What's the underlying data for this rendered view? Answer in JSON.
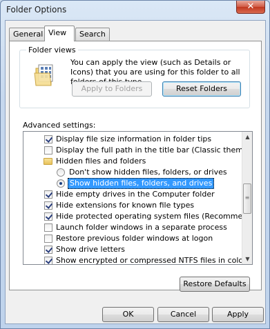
{
  "window": {
    "title": "Folder Options",
    "close_glyph": "✕"
  },
  "tabs": [
    {
      "label": "General",
      "active": false
    },
    {
      "label": "View",
      "active": true
    },
    {
      "label": "Search",
      "active": false
    }
  ],
  "folder_views": {
    "legend": "Folder views",
    "description": "You can apply the view (such as Details or Icons) that you are using for this folder to all folders of this type.",
    "icon": "folder-views-icon",
    "apply_label": "Apply to Folders",
    "reset_label": "Reset Folders"
  },
  "advanced": {
    "label": "Advanced settings:",
    "items": [
      {
        "kind": "checkbox",
        "label": "Display file size information in folder tips",
        "checked": true,
        "indent": 1
      },
      {
        "kind": "checkbox",
        "label": "Display the full path in the title bar (Classic theme only)",
        "checked": false,
        "indent": 1
      },
      {
        "kind": "folder",
        "label": "Hidden files and folders",
        "indent": 1
      },
      {
        "kind": "radio",
        "label": "Don't show hidden files, folders, or drives",
        "checked": false,
        "indent": 2
      },
      {
        "kind": "radio",
        "label": "Show hidden files, folders, and drives",
        "checked": true,
        "indent": 2,
        "selected": true
      },
      {
        "kind": "checkbox",
        "label": "Hide empty drives in the Computer folder",
        "checked": true,
        "indent": 1
      },
      {
        "kind": "checkbox",
        "label": "Hide extensions for known file types",
        "checked": true,
        "indent": 1
      },
      {
        "kind": "checkbox",
        "label": "Hide protected operating system files (Recommended)",
        "checked": true,
        "indent": 1
      },
      {
        "kind": "checkbox",
        "label": "Launch folder windows in a separate process",
        "checked": false,
        "indent": 1
      },
      {
        "kind": "checkbox",
        "label": "Restore previous folder windows at logon",
        "checked": false,
        "indent": 1
      },
      {
        "kind": "checkbox",
        "label": "Show drive letters",
        "checked": true,
        "indent": 1
      },
      {
        "kind": "checkbox",
        "label": "Show encrypted or compressed NTFS files in color",
        "checked": true,
        "indent": 1
      }
    ]
  },
  "restore_defaults_label": "Restore Defaults",
  "footer": {
    "ok_label": "OK",
    "cancel_label": "Cancel",
    "apply_label": "Apply"
  }
}
